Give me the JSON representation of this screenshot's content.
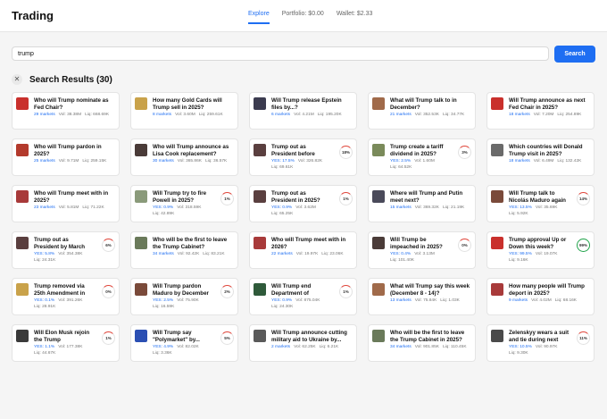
{
  "app": {
    "title": "Trading"
  },
  "nav": {
    "explore": "Explore",
    "portfolio": "Portfolio: $0.00",
    "wallet": "Wallet: $2.33"
  },
  "search": {
    "value": "trump",
    "button": "Search"
  },
  "results": {
    "title": "Search Results (30)",
    "close_icon": "close-icon"
  },
  "colors": {
    "accent": "#1e6ef2",
    "yes": "#1e6ef2",
    "green": "#21a34a",
    "red": "#e0453a"
  },
  "cards": [
    {
      "title": "Who will Trump nominate as Fed Chair?",
      "markets": "29 markets",
      "vol": "Vol: 38.38M",
      "liq": "Liq: 668.69K",
      "thumb": "#c9302c"
    },
    {
      "title": "How many Gold Cards will Trump sell in 2025?",
      "markets": "8 markets",
      "vol": "Vol: 3.60M",
      "liq": "Liq: 259.61K",
      "thumb": "#c9a24a"
    },
    {
      "title": "Will Trump release Epstein files by...?",
      "markets": "6 markets",
      "vol": "Vol: 4.21M",
      "liq": "Liq: 195.20K",
      "thumb": "#3b3b4f"
    },
    {
      "title": "What will Trump talk to in December?",
      "markets": "21 markets",
      "vol": "Vol: 352.53K",
      "liq": "Liq: 34.77K",
      "thumb": "#a06a4a"
    },
    {
      "title": "Will Trump announce as next Fed Chair in 2025?",
      "markets": "18 markets",
      "vol": "Vol: 7.20M",
      "liq": "Liq: 254.89K",
      "thumb": "#c9302c"
    },
    {
      "title": "Who will Trump pardon in 2025?",
      "markets": "25 markets",
      "vol": "Vol: 9.71M",
      "liq": "Liq: 259.15K",
      "thumb": "#b33a2c"
    },
    {
      "title": "Who will Trump announce as Lisa Cook replacement?",
      "markets": "30 markets",
      "vol": "Vol: 365.86K",
      "liq": "Liq: 36.57K",
      "thumb": "#4a3b38"
    },
    {
      "title": "Trump out as President before 2027?",
      "yes": "YES: 17.5%",
      "vol": "Vol: 326.82K",
      "liq": "Liq: 69.61K",
      "gauge": "18%",
      "thumb": "#5a3f3f"
    },
    {
      "title": "Trump create a tariff dividend in 2025?",
      "yes": "YES: 2.5%",
      "vol": "Vol: 1.60M",
      "liq": "Liq: 64.52K",
      "gauge": "3%",
      "thumb": "#7a8a5a"
    },
    {
      "title": "Which countries will Donald Trump visit in 2025?",
      "markets": "18 markets",
      "vol": "Vol: 6.49M",
      "liq": "Liq: 132.42K",
      "thumb": "#6a6a6a"
    },
    {
      "title": "Who will Trump meet with in 2025?",
      "markets": "23 markets",
      "vol": "Vol: 5.81M",
      "liq": "Liq: 71.22K",
      "thumb": "#a83a3a"
    },
    {
      "title": "Will Trump try to fire Powell in 2025?",
      "yes": "YES: 0.9%",
      "vol": "Vol: 318.59K",
      "liq": "Liq: 42.89K",
      "gauge": "1%",
      "thumb": "#8a9a7a"
    },
    {
      "title": "Trump out as President in 2025?",
      "yes": "YES: 0.9%",
      "vol": "Vol: 3.62M",
      "liq": "Liq: 65.25K",
      "gauge": "1%",
      "thumb": "#5a3f3f"
    },
    {
      "title": "Where will Trump and Putin meet next?",
      "markets": "15 markets",
      "vol": "Vol: 369.32K",
      "liq": "Liq: 21.19K",
      "thumb": "#4a4a5a"
    },
    {
      "title": "Will Trump talk to Nicolás Maduro again by...",
      "yes": "YES: 13.5%",
      "vol": "Vol: 35.69K",
      "liq": "Liq: 5.92K",
      "gauge": "14%",
      "thumb": "#7a4a3a"
    },
    {
      "title": "Trump out as President by March 31?",
      "yes": "YES: 5.8%",
      "vol": "Vol: 354.38K",
      "liq": "Liq: 24.31K",
      "gauge": "6%",
      "thumb": "#5a3f3f"
    },
    {
      "title": "Who will be the first to leave the Trump Cabinet?",
      "markets": "34 markets",
      "vol": "Vol: 92.42K",
      "liq": "Liq: 83.21K",
      "thumb": "#6a7a5a"
    },
    {
      "title": "Who will Trump meet with in 2026?",
      "markets": "22 markets",
      "vol": "Vol: 19.97K",
      "liq": "Liq: 23.06K",
      "thumb": "#a83a3a"
    },
    {
      "title": "Will Trump be impeached in 2025?",
      "yes": "YES: 0.4%",
      "vol": "Vol: 3.13M",
      "liq": "Liq: 101.40K",
      "gauge": "0%",
      "thumb": "#4a3b38"
    },
    {
      "title": "Trump approval Up or Down this week?",
      "yes": "YES: 99.5%",
      "vol": "Vol: 19.07K",
      "liq": "Liq: 9.16K",
      "gauge": "99%",
      "hi": true,
      "thumb": "#c9302c"
    },
    {
      "title": "Trump removed via 25th Amendment in 2025?",
      "yes": "YES: 0.1%",
      "vol": "Vol: 391.26K",
      "liq": "Liq: 28.91K",
      "gauge": "0%",
      "thumb": "#c9a24a"
    },
    {
      "title": "Will Trump pardon Maduro by December 31?",
      "yes": "YES: 2.5%",
      "vol": "Vol: 75.90K",
      "liq": "Liq: 16.59K",
      "gauge": "2%",
      "thumb": "#7a4a3a"
    },
    {
      "title": "Will Trump end Department of Educatio...",
      "yes": "YES: 0.9%",
      "vol": "Vol: 875.04K",
      "liq": "Liq: 24.30K",
      "gauge": "1%",
      "thumb": "#2f5a3a"
    },
    {
      "title": "What will Trump say this week (December 8 - 14)?",
      "markets": "13 markets",
      "vol": "Vol: 75.84K",
      "liq": "Liq: 1.03K",
      "thumb": "#a06a4a"
    },
    {
      "title": "How many people will Trump deport in 2025?",
      "markets": "9 markets",
      "vol": "Vol: 4.02M",
      "liq": "Liq: 68.16K",
      "thumb": "#a83a3a"
    },
    {
      "title": "Will Elon Musk rejoin the Trump Administration...",
      "yes": "YES: 1.1%",
      "vol": "Vol: 177.38K",
      "liq": "Liq: 44.67K",
      "gauge": "1%",
      "thumb": "#3a3a3a"
    },
    {
      "title": "Will Trump say \"Polymarket\" by...",
      "yes": "YES: 4.9%",
      "vol": "Vol: 82.02K",
      "liq": "Liq: 3.36K",
      "gauge": "5%",
      "thumb": "#2b4fb3"
    },
    {
      "title": "Will Trump announce cutting military aid to Ukraine by...",
      "markets": "2 markets",
      "vol": "Vol: 62.25K",
      "liq": "Liq: 6.21K",
      "thumb": "#5a5a5a"
    },
    {
      "title": "Who will be the first to leave the Trump Cabinet in 2025?",
      "markets": "34 markets",
      "vol": "Vol: 901.85K",
      "liq": "Liq: 110.45K",
      "thumb": "#6a7a5a"
    },
    {
      "title": "Zelenskyy wears a suit and tie during next Trump...",
      "yes": "YES: 10.5%",
      "vol": "Vol: 90.97K",
      "liq": "Liq: 9.30K",
      "gauge": "11%",
      "thumb": "#4a4a4a"
    }
  ]
}
